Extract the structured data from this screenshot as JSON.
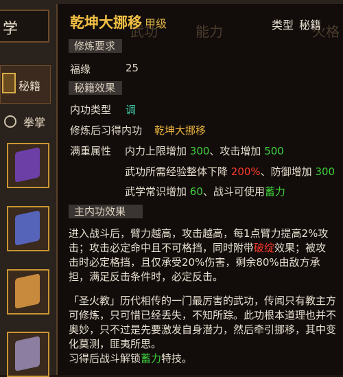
{
  "left": {
    "tab_label": "学",
    "sub_label": "秘籍",
    "filter_label": "拳掌"
  },
  "bg_labels": {
    "tab1": "武功",
    "tab2": "能力",
    "tab3": "火格"
  },
  "header": {
    "title": "乾坤大挪移",
    "grade": "甲级",
    "type_label": "类型",
    "type_value": "秘籍"
  },
  "requirements": {
    "section": "修炼要求",
    "fate_label": "福缘",
    "fate_value": "25"
  },
  "effects": {
    "section": "秘籍效果",
    "neigong_label": "内功类型",
    "neigong_value": "调",
    "learn_label": "修炼后习得内功",
    "learn_value": "乾坤大挪移",
    "full_label": "满重属性",
    "line1_a": "内力上限增加 ",
    "line1_b": "300",
    "line1_c": "、攻击增加 ",
    "line1_d": "500",
    "line2_a": "武功所需经验整体下降 ",
    "line2_b": "200%",
    "line2_c": "、防御增加 ",
    "line2_d": "300",
    "line3_a": "武学常识增加 ",
    "line3_b": "60",
    "line3_c": "、战斗可使用",
    "line3_d": "蓄力"
  },
  "main_effect": {
    "section": "主内功效果",
    "p1_a": "进入战斗后，臂力越高，攻击越高，每1点臂力提高2%攻击；攻击必定命中且不可格挡，同时附带",
    "p1_b": "破绽",
    "p1_c": "效果；被攻击时必定格挡，且仅承受20%伤害，剩余80%由敌方承担，满足反击条件时，必定反击。"
  },
  "description": {
    "p_a": "「圣火教」历代相传的一门最厉害的武功，传闻只有教主方可修炼，只可惜已经丢失，不知所踪。此功根本道理也并不奥妙，只不过是先要激发自身潜力，然后牵引挪移，其中变化莫测，匪夷所思。",
    "p_b": "习得后战斗解锁",
    "p_c": "蓄力",
    "p_d": "特技。"
  }
}
